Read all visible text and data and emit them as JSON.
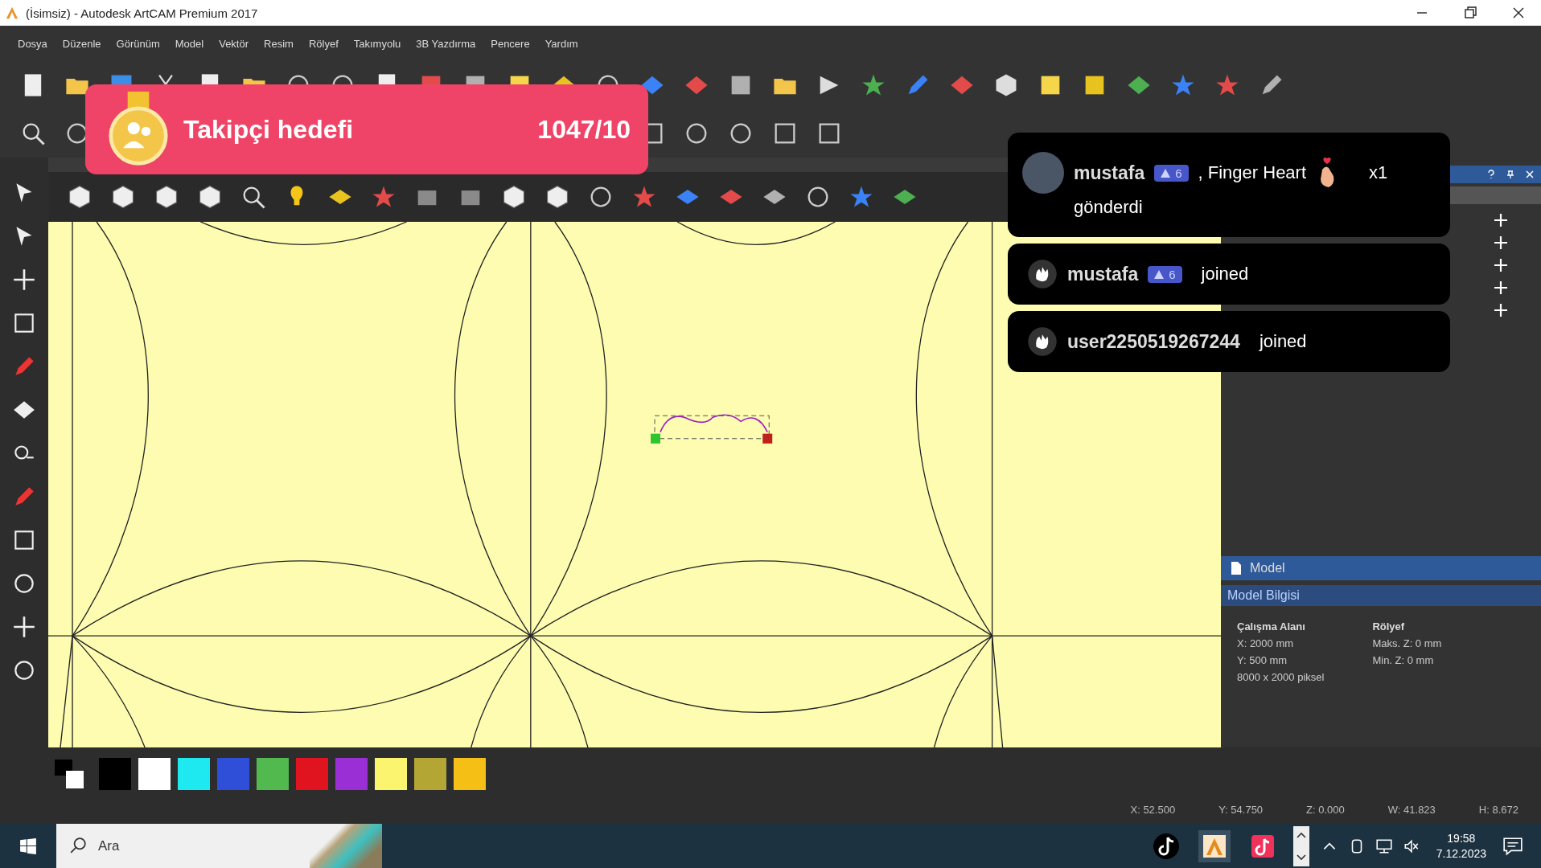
{
  "window": {
    "title": "(İsimsiz) - Autodesk ArtCAM Premium 2017"
  },
  "menu": [
    "Dosya",
    "Düzenle",
    "Görünüm",
    "Model",
    "Vektör",
    "Resim",
    "Rölyef",
    "Takımyolu",
    "3B Yazdırma",
    "Pencere",
    "Yardım"
  ],
  "model_panel": {
    "title": "Model",
    "section": "Model Bilgisi",
    "columns": [
      {
        "heading": "Çalışma Alanı",
        "lines": [
          "X: 2000 mm",
          "Y: 500 mm",
          "8000 x 2000 piksel"
        ]
      },
      {
        "heading": "Rölyef",
        "lines": [
          "Maks. Z: 0 mm",
          "Min. Z: 0 mm"
        ]
      }
    ]
  },
  "palette": [
    {
      "color": "#000000"
    },
    {
      "color": "#ffffff"
    },
    {
      "color": "#1ee8f0"
    },
    {
      "color": "#2f4fd8"
    },
    {
      "color": "#52b94f"
    },
    {
      "color": "#e0141e"
    },
    {
      "color": "#9a2fd6"
    },
    {
      "color": "#fbf46e"
    },
    {
      "color": "#b3a635"
    },
    {
      "color": "#f5bf16"
    }
  ],
  "status_bar": [
    "X: 52.500",
    "Y: 54.750",
    "Z: 0.000",
    "W: 41.823",
    "H: 8.672"
  ],
  "follower_goal": {
    "label": "Takipçi hedefi",
    "count": "1047/10"
  },
  "notifications": [
    {
      "kind": "gift",
      "user": "mustafa",
      "badge": "6",
      "gift": ", Finger Heart",
      "count": "x1",
      "action": "gönderdi"
    },
    {
      "kind": "join",
      "user": "mustafa",
      "badge": "6",
      "action": "joined"
    },
    {
      "kind": "join",
      "user": "user2250519267244",
      "action": "joined"
    }
  ],
  "taskbar": {
    "search": {
      "placeholder": "Ara"
    },
    "time": "19:58",
    "date": "7.12.2023"
  }
}
